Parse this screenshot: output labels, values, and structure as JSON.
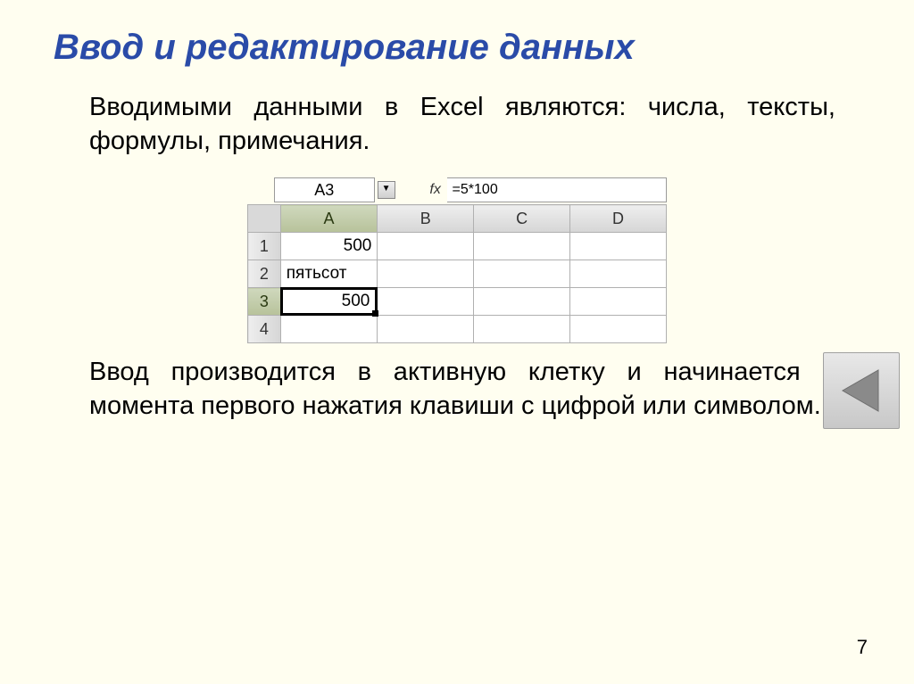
{
  "title": "Ввод и редактирование данных",
  "para1": "Вводимыми данными в Excel являются: числа, тексты, формулы, примечания.",
  "para2": "Ввод производится в активную клетку и начинается с момента первого нажатия клавиши с цифрой или символом.",
  "page_number": "7",
  "excel": {
    "name_box": "A3",
    "fx_label": "fx",
    "formula_bar": "=5*100",
    "columns": [
      "A",
      "B",
      "C",
      "D"
    ],
    "rows": [
      "1",
      "2",
      "3",
      "4"
    ],
    "cells": {
      "A1": "500",
      "A2": "пятьсот",
      "A3": "500"
    },
    "active_col": "A",
    "active_row": "3"
  },
  "nav": {
    "icon": "back-triangle"
  }
}
